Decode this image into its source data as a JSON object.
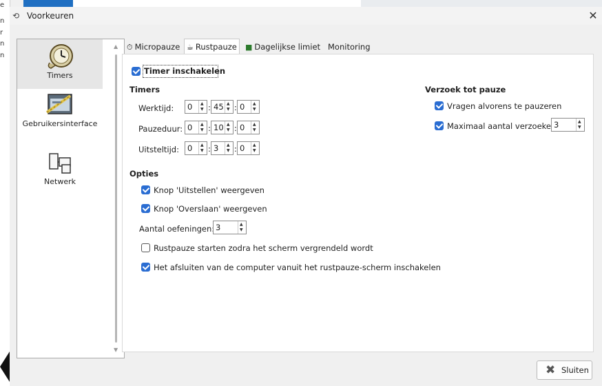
{
  "window": {
    "title": "Voorkeuren",
    "close_symbol": "✕"
  },
  "background": {
    "left_chars": [
      "e",
      "n",
      "r",
      "n",
      "n"
    ]
  },
  "sidebar": {
    "items": [
      {
        "label": "Timers",
        "icon": "clock-icon",
        "selected": true
      },
      {
        "label": "Gebruikersinterface",
        "icon": "interface-icon",
        "selected": false
      },
      {
        "label": "Netwerk",
        "icon": "network-icon",
        "selected": false
      }
    ]
  },
  "tabs": [
    {
      "label": "Micropauze",
      "icon": "stopwatch-icon"
    },
    {
      "label": "Rustpauze",
      "icon": "rest-icon",
      "active": true
    },
    {
      "label": "Dagelijkse limiet",
      "icon": "daily-limit-icon"
    },
    {
      "label": "Monitoring",
      "icon": ""
    }
  ],
  "panel": {
    "enable_timer": {
      "label": "Timer inschakelen",
      "checked": true
    },
    "timers": {
      "heading": "Timers",
      "rows": [
        {
          "label": "Werktijd:",
          "h": "0",
          "m": "45",
          "s": "0"
        },
        {
          "label": "Pauzeduur:",
          "h": "0",
          "m": "10",
          "s": "0"
        },
        {
          "label": "Uitsteltijd:",
          "h": "0",
          "m": "3",
          "s": "0"
        }
      ],
      "separator": ":"
    },
    "request": {
      "heading": "Verzoek tot pauze",
      "ask_before": {
        "label": "Vragen alvorens te pauzeren",
        "checked": true
      },
      "max_requests": {
        "label": "Maximaal aantal verzoeken:",
        "checked": true,
        "value": "3"
      }
    },
    "options": {
      "heading": "Opties",
      "postpone": {
        "label": "Knop 'Uitstellen' weergeven",
        "checked": true
      },
      "skip": {
        "label": "Knop 'Overslaan' weergeven",
        "checked": true
      },
      "exercises": {
        "label": "Aantal oefeningen:",
        "value": "3"
      },
      "start_on_lock": {
        "label": "Rustpauze starten zodra het scherm vergrendeld wordt",
        "checked": false
      },
      "allow_shutdown": {
        "label": "Het afsluiten van de computer vanuit het rustpauze-scherm inschakelen",
        "checked": true
      }
    }
  },
  "buttons": {
    "close_label": "Sluiten"
  },
  "colors": {
    "checkbox": "#2a6dd2",
    "panel_bg": "#ffffff",
    "dialog_bg": "#f0f0f0"
  }
}
